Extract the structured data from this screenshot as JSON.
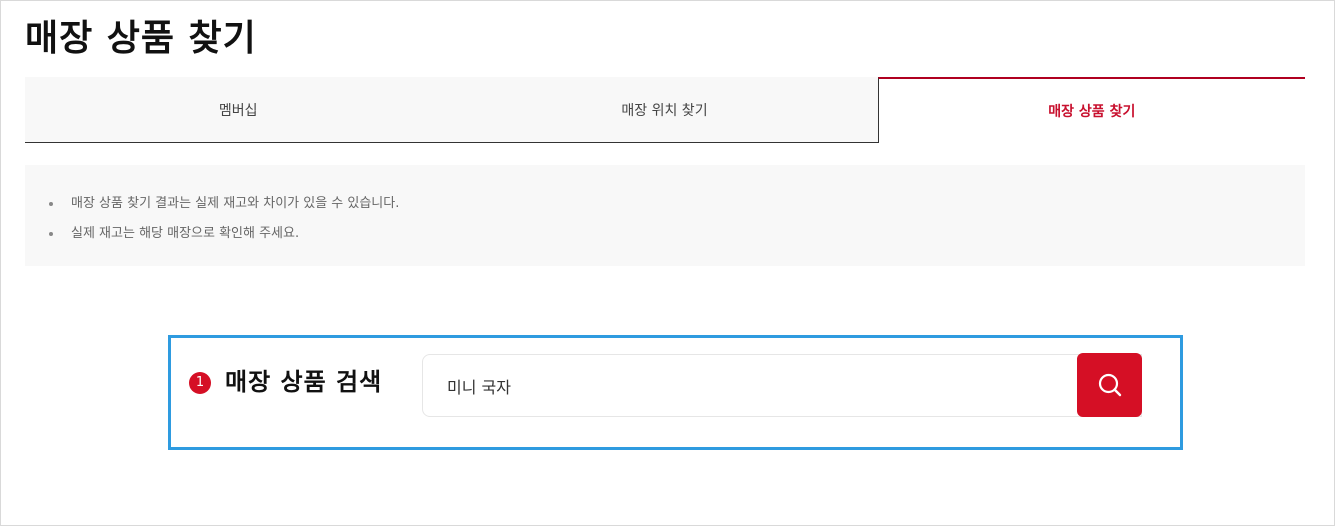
{
  "page": {
    "title": "매장 상품 찾기"
  },
  "tabs": [
    {
      "label": "멤버십",
      "active": false
    },
    {
      "label": "매장 위치 찾기",
      "active": false
    },
    {
      "label": "매장 상품 찾기",
      "active": true
    }
  ],
  "notice": {
    "items": [
      "매장 상품 찾기 결과는 실제 재고와 차이가 있을 수 있습니다.",
      "실제 재고는 해당 매장으로 확인해 주세요."
    ]
  },
  "search": {
    "step_number": "1",
    "label": "매장 상품 검색",
    "value": "미니 국자",
    "button_icon": "search-icon"
  },
  "colors": {
    "accent_red": "#d50f25",
    "highlight_blue": "#2e9be0"
  }
}
